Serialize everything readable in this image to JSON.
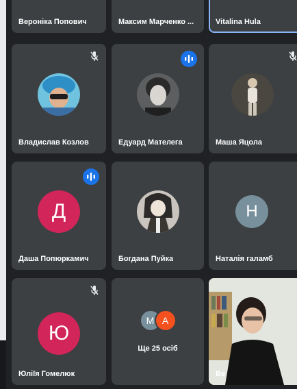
{
  "tiles": {
    "top_row": [
      {
        "name": "Вероніка Попович"
      },
      {
        "name": "Максим Марченко ..."
      },
      {
        "name": "Vitalina Hula"
      }
    ],
    "row1": [
      {
        "name": "Владислав Козлов",
        "mic": "muted",
        "avatar_icon": "photo-avatar-blue-hat"
      },
      {
        "name": "Едуард Мателега",
        "mic": "speaking",
        "avatar_icon": "photo-avatar-dark"
      },
      {
        "name": "Маша Яцола",
        "mic": "muted",
        "avatar_icon": "photo-avatar-standing"
      }
    ],
    "row2": [
      {
        "name": "Даша Попюркамич",
        "mic": "speaking",
        "letter": "Д",
        "color": "#d2255a"
      },
      {
        "name": "Богдана Пуйка",
        "mic": "none",
        "avatar_icon": "photo-avatar-anime"
      },
      {
        "name": "Наталія галамб",
        "mic": "none",
        "letter": "Н",
        "color": "#78909c"
      }
    ],
    "row3": [
      {
        "name": "Юліїя Гомелюк",
        "mic": "muted",
        "letter": "Ю",
        "color": "#d2255a"
      },
      {
        "more_label": "Ще 25 осіб",
        "initials": [
          "М",
          "А"
        ],
        "colors": [
          "#78909c",
          "#f4511e"
        ]
      },
      {
        "name": "Ве",
        "video_icon": "camera-video-feed"
      }
    ]
  },
  "colors": {
    "background": "#202124",
    "tile": "#3c4043",
    "speaking_badge": "#1a73e8",
    "active_border": "#8ab4f8"
  }
}
